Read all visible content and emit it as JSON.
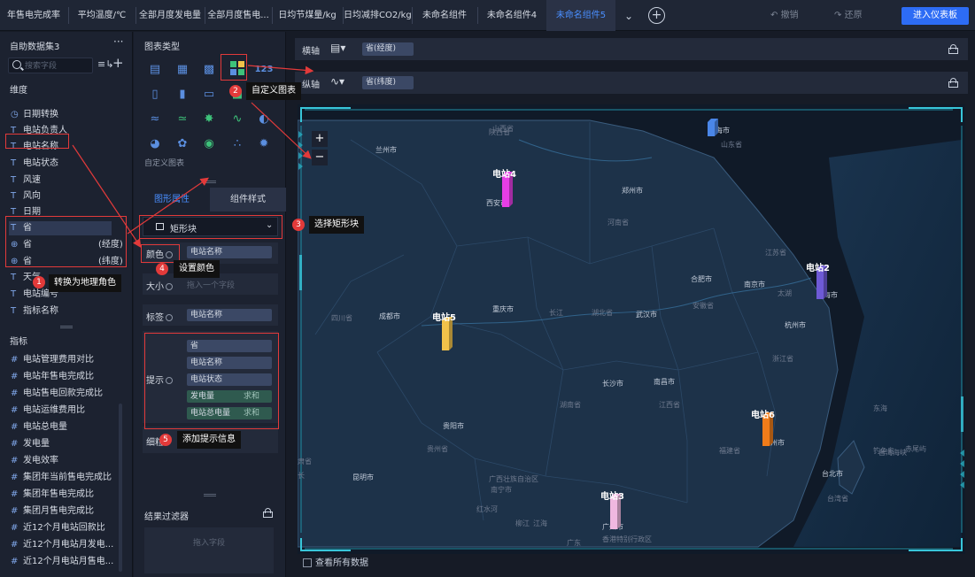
{
  "tabs": [
    {
      "label": "年售电完成率",
      "selected": false
    },
    {
      "label": "平均温度/℃",
      "selected": false
    },
    {
      "label": "全部月度发电量",
      "selected": false
    },
    {
      "label": "全部月度售电...",
      "selected": false
    },
    {
      "label": "日均节煤量/kg",
      "selected": false
    },
    {
      "label": "日均减排CO2/kg",
      "selected": false
    },
    {
      "label": "未命名组件",
      "selected": false
    },
    {
      "label": "未命名组件4",
      "selected": false
    },
    {
      "label": "未命名组件5",
      "selected": true
    }
  ],
  "toolbar": {
    "undo": "撤销",
    "redo": "还原",
    "enter_dashboard": "进入仪表板"
  },
  "dataset": {
    "title": "自助数据集3",
    "more": "···",
    "search_placeholder": "搜索字段",
    "dimension_label": "维度",
    "dimensions": [
      {
        "icon": "clock",
        "name": "日期转换",
        "role": ""
      },
      {
        "icon": "T",
        "name": "电站负责人",
        "role": ""
      },
      {
        "icon": "T",
        "name": "电站名称",
        "role": ""
      },
      {
        "icon": "T",
        "name": "电站状态",
        "role": ""
      },
      {
        "icon": "T",
        "name": "风速",
        "role": ""
      },
      {
        "icon": "T",
        "name": "风向",
        "role": ""
      },
      {
        "icon": "T",
        "name": "日期",
        "role": ""
      },
      {
        "icon": "T",
        "name": "省",
        "role": ""
      },
      {
        "icon": "globe",
        "name": "省",
        "role": "(经度)"
      },
      {
        "icon": "globe",
        "name": "省",
        "role": "(纬度)"
      },
      {
        "icon": "T",
        "name": "天气",
        "role": ""
      },
      {
        "icon": "T",
        "name": "电站编号",
        "role": ""
      },
      {
        "icon": "T",
        "name": "指标名称",
        "role": ""
      }
    ],
    "metric_label": "指标",
    "metrics": [
      "电站管理费用对比",
      "电站年售电完成比",
      "电站售电回款完成比",
      "电站运维费用比",
      "电站总电量",
      "发电量",
      "发电效率",
      "集团年当前售电完成比",
      "集团年售电完成比",
      "集团月售电完成比",
      "近12个月电站回款比",
      "近12个月电站月发电...",
      "近12个月电站月售电..."
    ]
  },
  "chart_panel": {
    "title": "图表类型",
    "custom_label": "自定义图表",
    "prop_tab": "图形属性",
    "style_tab": "组件样式",
    "shape": "矩形块",
    "color_label": "颜色",
    "color_field": "电站名称",
    "size_label": "大小",
    "size_placeholder": "拖入一个字段",
    "label_label": "标签",
    "label_field": "电站名称",
    "tip_label": "提示",
    "tip_fields": [
      {
        "name": "省",
        "agg": ""
      },
      {
        "name": "电站名称",
        "agg": ""
      },
      {
        "name": "电站状态",
        "agg": ""
      },
      {
        "name": "发电量",
        "agg": "求和"
      },
      {
        "name": "电站总电量",
        "agg": "求和"
      }
    ],
    "detail_label": "细粒",
    "filter_title": "结果过滤器",
    "filter_placeholder": "拖入字段"
  },
  "axes": {
    "x_label": "横轴",
    "x_field": "省(经度)",
    "y_label": "纵轴",
    "y_field": "省(纬度)"
  },
  "map": {
    "zoom_in": "+",
    "zoom_out": "−",
    "show_all": "查看所有数据",
    "stations": [
      {
        "name": "电站4",
        "color": "#e63ee6"
      },
      {
        "name": "电站2",
        "color": "#6e5ad6"
      },
      {
        "name": "电站5",
        "color": "#f2c24a"
      },
      {
        "name": "电站6",
        "color": "#f07c1a"
      },
      {
        "name": "电站3",
        "color": "#f0b8e0"
      },
      {
        "name": "",
        "color": "#4a86e8"
      }
    ],
    "places": [
      "兰州市",
      "山西省",
      "陕西省",
      "青海市",
      "山东省",
      "西安市",
      "郑州市",
      "河南省",
      "江苏省",
      "合肥市",
      "南京市",
      "太湖",
      "上海市",
      "安徽省",
      "四川省",
      "成都市",
      "重庆市",
      "长江",
      "湖北省",
      "武汉市",
      "杭州市",
      "浙江省",
      "长沙市",
      "南昌市",
      "湖南省",
      "江西省",
      "东海",
      "台湾海峡",
      "福建省",
      "州市",
      "贵阳市",
      "贵州省",
      "昆明市",
      "广西壮族自治区",
      "南宁市",
      "广州市",
      "香港特别行政区",
      "台北市",
      "台湾省",
      "钓鱼岛",
      "赤尾屿",
      "肃省",
      "长",
      "广东",
      "红水河",
      "柳江",
      "江海"
    ]
  },
  "annotations": [
    {
      "num": "1",
      "text": "转换为地理角色"
    },
    {
      "num": "2",
      "text": "自定义图表"
    },
    {
      "num": "3",
      "text": "选择矩形块"
    },
    {
      "num": "4",
      "text": "设置颜色"
    },
    {
      "num": "5",
      "text": "添加提示信息"
    }
  ]
}
